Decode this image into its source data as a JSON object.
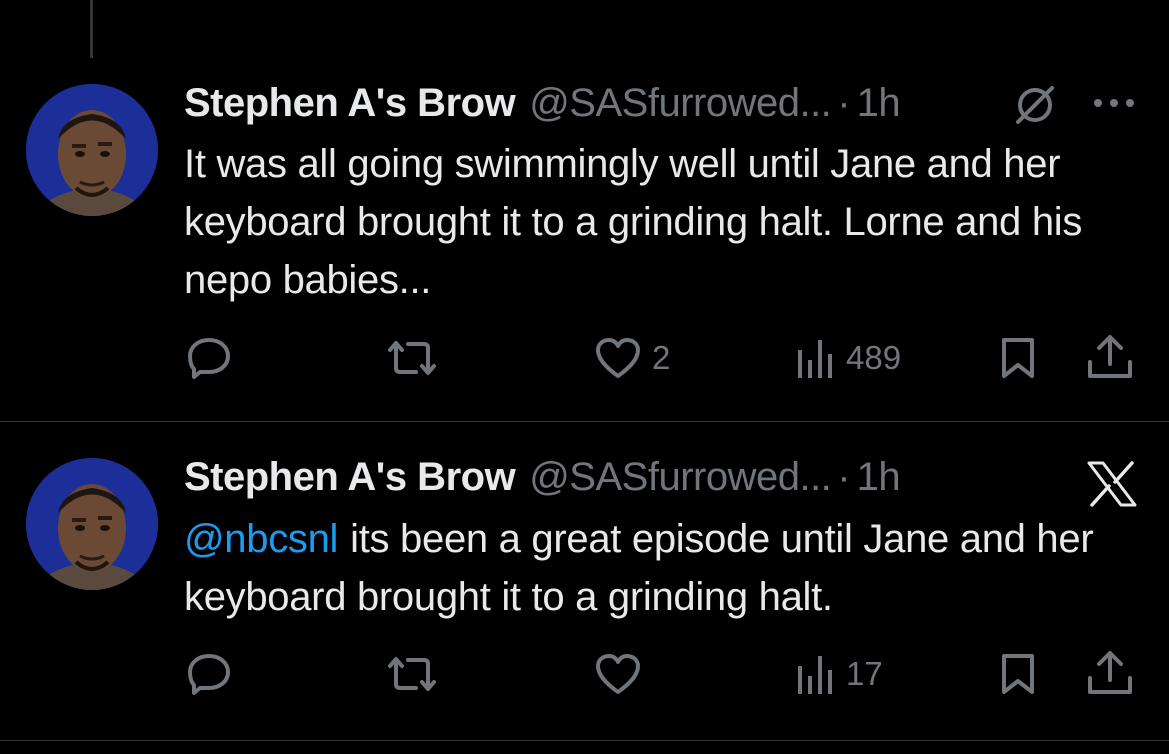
{
  "tweets": [
    {
      "display_name": "Stephen A's Brow",
      "handle": "@SASfurrowed...",
      "separator": "·",
      "time": "1h",
      "text": "It was all going swimmingly well until Jane and her keyboard brought it to a grinding halt. Lorne and his nepo babies...",
      "top_icon": "grok-icon",
      "likes": "2",
      "views": "489"
    },
    {
      "display_name": "Stephen A's Brow",
      "handle": "@SASfurrowed...",
      "separator": "·",
      "time": "1h",
      "mention": "@nbcsnl",
      "text": "its been a great episode until Jane and her keyboard brought it to a grinding halt.",
      "top_icon": "x-logo-icon",
      "views": "17"
    }
  ],
  "colors": {
    "background": "#000000",
    "text": "#e7e9ea",
    "muted": "#71767b",
    "link": "#1d9bf0",
    "divider": "#2f3336"
  }
}
